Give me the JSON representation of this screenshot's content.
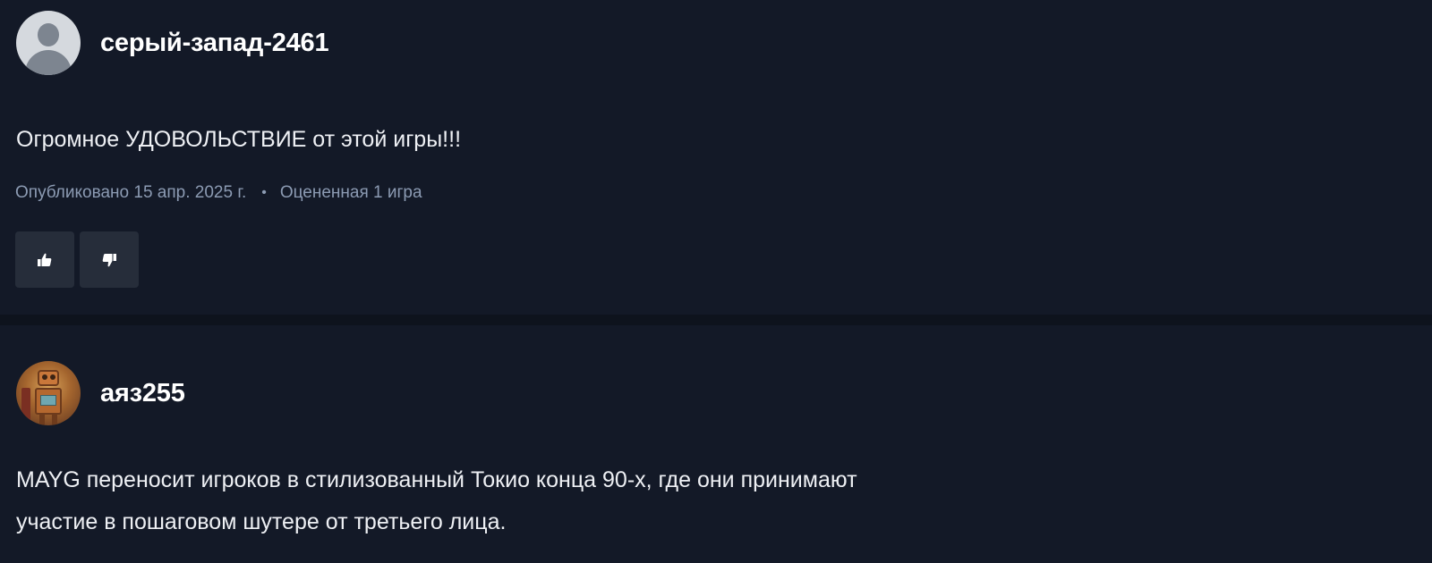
{
  "reviews": [
    {
      "username": "серый-запад-2461",
      "avatar": "default-user-avatar",
      "text_lines": [
        "Огромное УДОВОЛЬСТВИЕ от этой игры!!!"
      ],
      "published": "Опубликовано 15 апр. 2025 г.",
      "separator": "•",
      "rated": "Оцененная 1 игра",
      "like_icon": "thumbs-up-icon",
      "dislike_icon": "thumbs-down-icon"
    },
    {
      "username": "аяз255",
      "avatar": "robot-avatar",
      "text_lines": [
        "MAYG переносит игроков в стилизованный Токио конца 90-х, где они принимают",
        "участие в пошаговом шутере от третьего лица."
      ]
    }
  ],
  "colors": {
    "background": "#131927",
    "divider": "#0e131d",
    "meta_text": "#8c9bb3",
    "button_bg": "#262d3a"
  }
}
